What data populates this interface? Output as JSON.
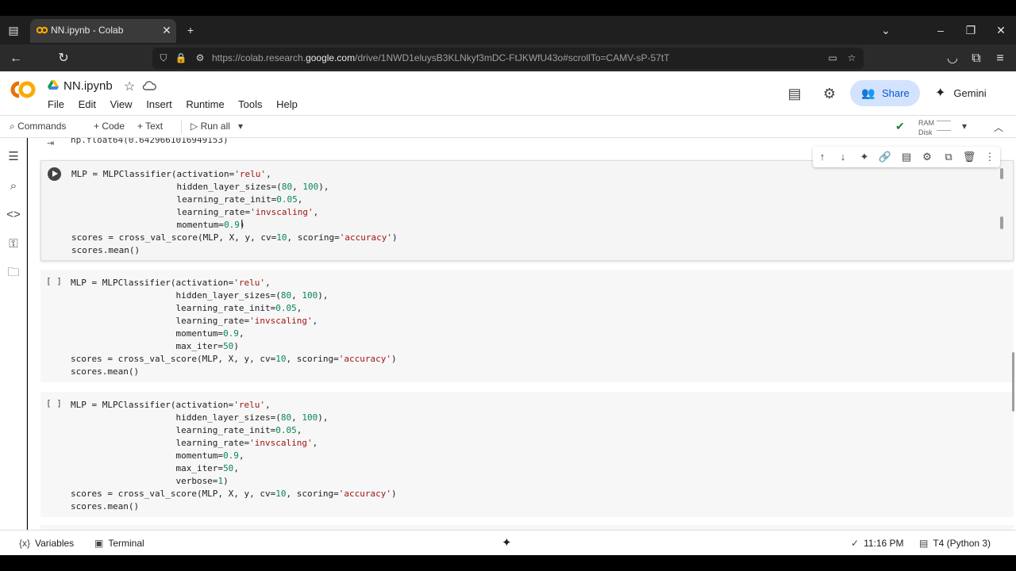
{
  "browser": {
    "tab_title": "NN.ipynb - Colab",
    "url_prefix": "https://colab.research.",
    "url_host": "google.com",
    "url_path": "/drive/1NWD1eluysB3KLNkyf3mDC-FtJKWfU43o#scrollTo=CAMV-sP-57tT"
  },
  "colab": {
    "logo": "CO",
    "doc_title": "NN.ipynb",
    "menu": [
      "File",
      "Edit",
      "View",
      "Insert",
      "Runtime",
      "Tools",
      "Help"
    ],
    "share_label": "Share",
    "gemini_label": "Gemini"
  },
  "toolbar": {
    "commands": "Commands",
    "add_code": "+ Code",
    "add_text": "+ Text",
    "run_all": "Run all",
    "ram_label": "RAM",
    "disk_label": "Disk"
  },
  "notebook": {
    "prev_output": "np.float64(0.6429661016949153)",
    "cells": [
      {
        "exec": "",
        "lines": [
          "MLP = MLPClassifier(activation='relu',",
          "                    hidden_layer_sizes=(80, 100),",
          "                    learning_rate_init=0.05,",
          "                    learning_rate='invscaling',",
          "                    momentum=0.9)",
          "scores = cross_val_score(MLP, X, y, cv=10, scoring='accuracy')",
          "scores.mean()"
        ]
      },
      {
        "exec": "[ ]",
        "lines": [
          "MLP = MLPClassifier(activation='relu',",
          "                    hidden_layer_sizes=(80, 100),",
          "                    learning_rate_init=0.05,",
          "                    learning_rate='invscaling',",
          "                    momentum=0.9,",
          "                    max_iter=50)",
          "scores = cross_val_score(MLP, X, y, cv=10, scoring='accuracy')",
          "scores.mean()"
        ]
      },
      {
        "exec": "[ ]",
        "lines": [
          "MLP = MLPClassifier(activation='relu',",
          "                    hidden_layer_sizes=(80, 100),",
          "                    learning_rate_init=0.05,",
          "                    learning_rate='invscaling',",
          "                    momentum=0.9,",
          "                    max_iter=50,",
          "                    verbose=1)",
          "scores = cross_val_score(MLP, X, y, cv=10, scoring='accuracy')",
          "scores.mean()"
        ]
      }
    ]
  },
  "statusbar": {
    "variables": "Variables",
    "terminal": "Terminal",
    "time": "11:16 PM",
    "runtime": "T4 (Python 3)"
  },
  "colors": {
    "keyword": "#202124",
    "string": "#a31515",
    "number": "#098658",
    "share_bg": "#d3e3fd",
    "accent": "#0b57d0"
  }
}
